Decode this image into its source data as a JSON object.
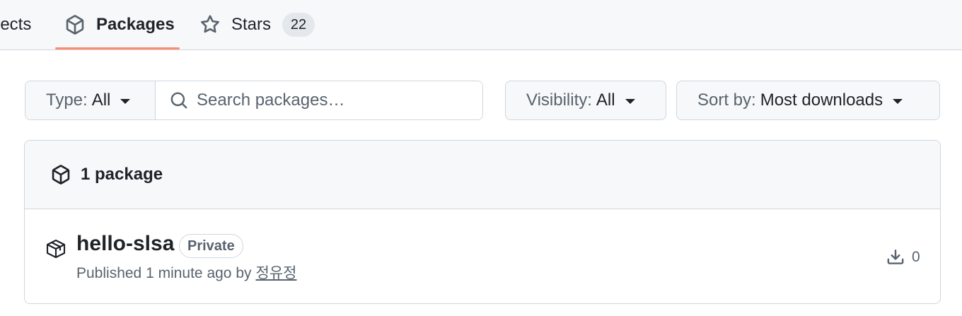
{
  "tabs": {
    "projects_label": "jects",
    "packages_label": "Packages",
    "stars_label": "Stars",
    "stars_count": "22"
  },
  "filters": {
    "type_prefix": "Type:",
    "type_value": "All",
    "search_placeholder": "Search packages…",
    "visibility_prefix": "Visibility:",
    "visibility_value": "All",
    "sort_prefix": "Sort by:",
    "sort_value": "Most downloads"
  },
  "packages_box": {
    "header_title": "1 package",
    "items": [
      {
        "name": "hello-slsa",
        "visibility_badge": "Private",
        "published_text": "Published 1 minute ago by",
        "author": "정유정",
        "downloads": "0"
      }
    ]
  },
  "colors": {
    "accent_underline": "#fd8c73",
    "border": "#d0d7de",
    "muted_text": "#59636e",
    "subtle_bg": "#f6f8fa"
  },
  "icons": {
    "packages_tab": "package-icon",
    "stars_tab": "star-icon",
    "search": "search-icon",
    "box_header": "package-icon",
    "row": "package-icon",
    "downloads": "download-icon"
  }
}
